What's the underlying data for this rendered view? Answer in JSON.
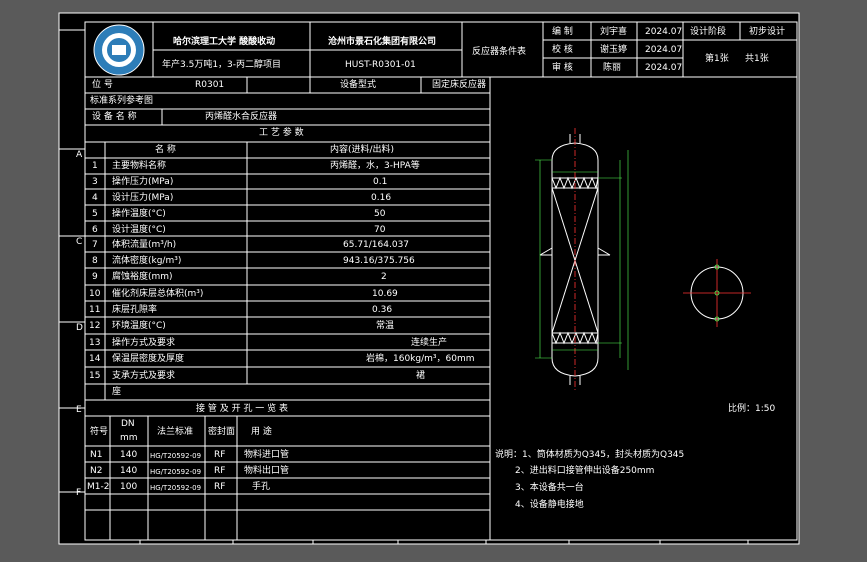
{
  "title_block": {
    "school": "哈尔滨理工大学 酸酸收动",
    "company": "沧州市景石化集团有限公司",
    "project": "年产3.5万吨1，3-丙二醇项目",
    "doc_no": "HUST-R0301-01",
    "doc_title": "反应器条件表",
    "roles": [
      "编 制",
      "校 核",
      "审 核"
    ],
    "names": [
      "刘宇喜",
      "谢玉婷",
      "陈丽"
    ],
    "dates": [
      "2024.07",
      "2024.07",
      "2024.07"
    ],
    "stage_label": "设计阶段",
    "stage_value": "初步设计",
    "sheet": "第1张",
    "total": "共1张"
  },
  "header": {
    "tag_label": "位 号",
    "tag_value": "R0301",
    "type_label": "设备型式",
    "type_value": "固定床反应器",
    "std_label": "标准系列参考图",
    "name_label": "设 备 名 称",
    "name_value": "丙烯醛水合反应器",
    "params_title": "工 艺 参 数"
  },
  "params_header": {
    "name": "名 称",
    "value": "内容(进料/出料)"
  },
  "params": [
    {
      "no": "1",
      "name": "主要物料名称",
      "value": "丙烯醛，水，3-HPA等"
    },
    {
      "no": "3",
      "name": "操作压力(MPa)",
      "value": "0.1"
    },
    {
      "no": "4",
      "name": "设计压力(MPa)",
      "value": "0.16"
    },
    {
      "no": "5",
      "name": "操作温度(°C)",
      "value": "50"
    },
    {
      "no": "6",
      "name": "设计温度(°C)",
      "value": "70"
    },
    {
      "no": "7",
      "name": "体积流量(m³/h)",
      "value": "65.71/164.037"
    },
    {
      "no": "8",
      "name": "流体密度(kg/m³)",
      "value": "943.16/375.756"
    },
    {
      "no": "9",
      "name": "腐蚀裕度(mm)",
      "value": "2"
    },
    {
      "no": "10",
      "name": "催化剂床层总体积(m³)",
      "value": "10.69"
    },
    {
      "no": "11",
      "name": "床层孔隙率",
      "value": "0.36"
    },
    {
      "no": "12",
      "name": "环境温度(°C)",
      "value": "常温"
    },
    {
      "no": "13",
      "name": "操作方式及要求",
      "value": "连续生产"
    },
    {
      "no": "14",
      "name": "保温层密度及厚度",
      "value": "岩棉，160kg/m³，60mm"
    },
    {
      "no": "15",
      "name": "支承方式及要求",
      "value": "裙"
    }
  ],
  "extra_row": "座",
  "nozzle_title": "接 管 及 开 孔 一 览 表",
  "nozzle_header": [
    "符号",
    "DN",
    "mm",
    "法兰标准",
    "密封面",
    "用 途"
  ],
  "nozzles": [
    {
      "sym": "N1",
      "dn": "140",
      "std": "HG/T20592-09",
      "face": "RF",
      "use": "物料进口管"
    },
    {
      "sym": "N2",
      "dn": "140",
      "std": "HG/T20592-09",
      "face": "RF",
      "use": "物料出口管"
    },
    {
      "sym": "M1-2",
      "dn": "100",
      "std": "HG/T20592-09",
      "face": "RF",
      "use": "手孔"
    }
  ],
  "notes": [
    "说明：1、筒体材质为Q345，封头材质为Q345",
    "2、进出料口接管伸出设备250mm",
    "3、本设备共一台",
    "4、设备静电接地"
  ],
  "scale": "比例：1:50",
  "frame_letters": [
    "A",
    "B",
    "C",
    "D",
    "E",
    "F"
  ],
  "colors": {
    "background": "#5a5a5a",
    "sheet": "#000000",
    "line": "#ffffff",
    "vessel": "#ffffff",
    "center": "#ff3333",
    "dim": "#55ff55"
  }
}
